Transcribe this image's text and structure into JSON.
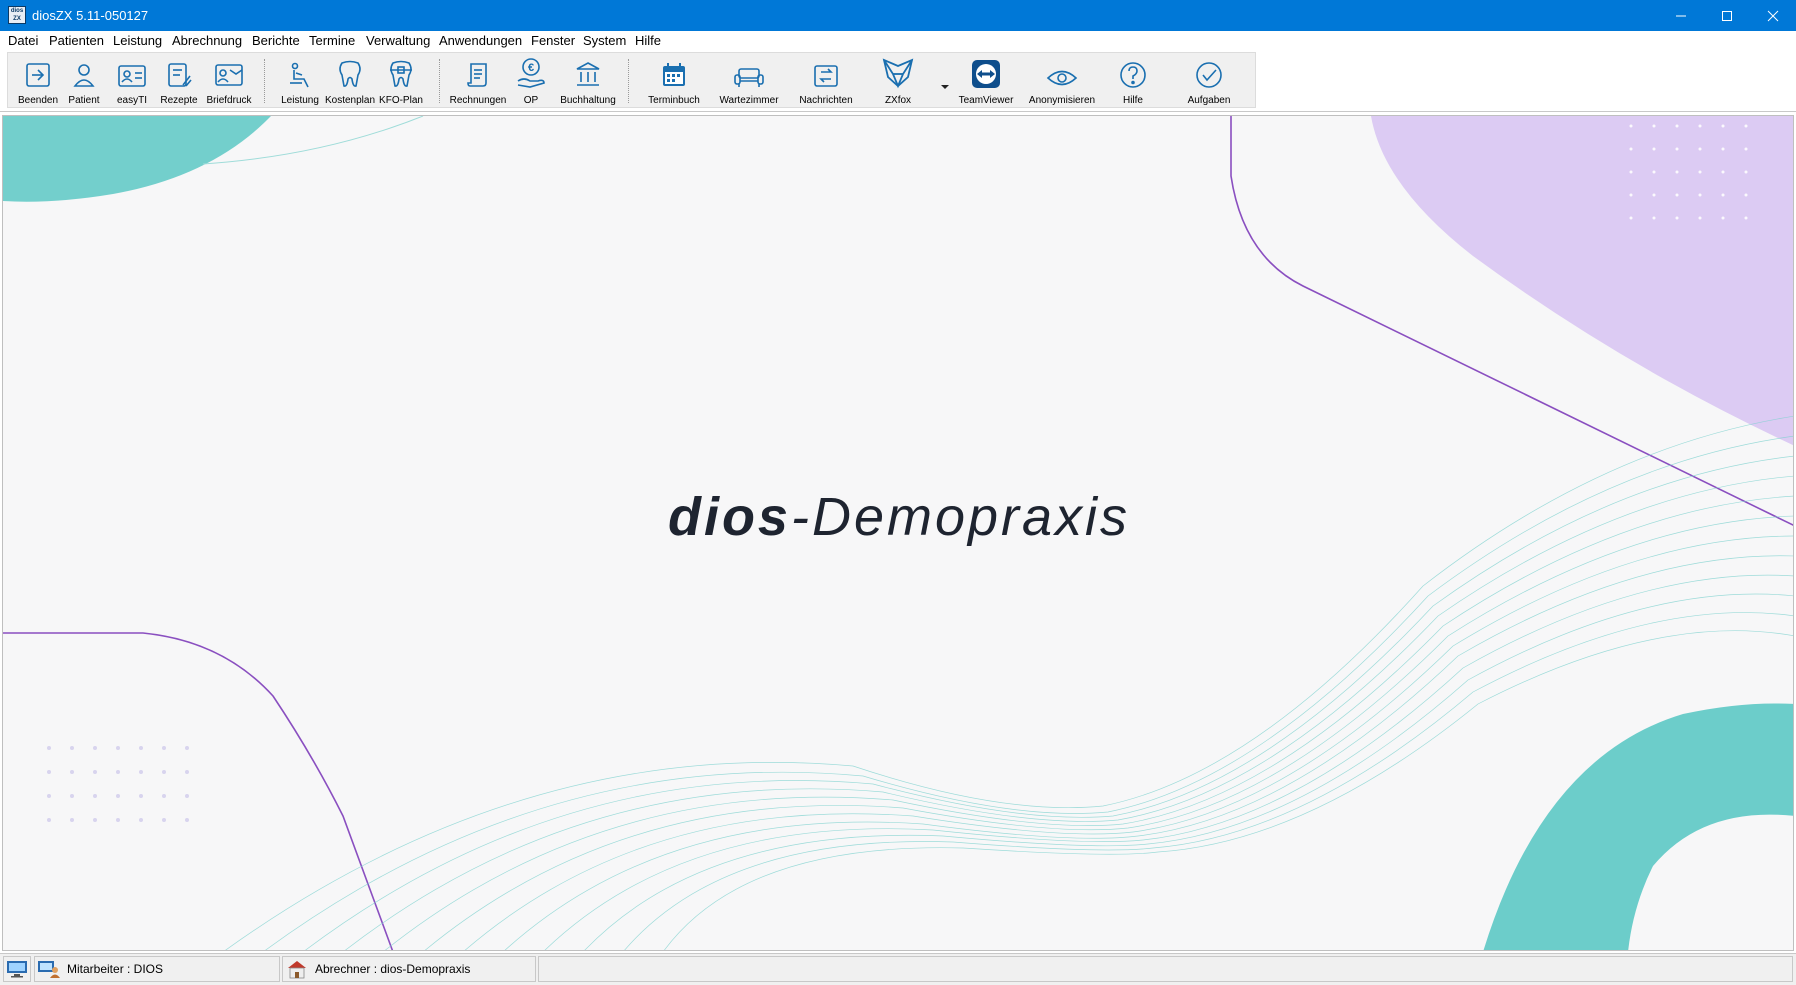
{
  "window": {
    "title": "diosZX 5.11-050127",
    "app_icon_text": "dios ZX"
  },
  "menu": [
    {
      "label": "Datei"
    },
    {
      "label": "Patienten"
    },
    {
      "label": "Leistung"
    },
    {
      "label": "Abrechnung"
    },
    {
      "label": "Berichte"
    },
    {
      "label": "Termine"
    },
    {
      "label": "Verwaltung"
    },
    {
      "label": "Anwendungen"
    },
    {
      "label": "Fenster"
    },
    {
      "label": "System"
    },
    {
      "label": "Hilfe"
    }
  ],
  "toolbar": [
    {
      "label": "Beenden",
      "icon": "exit-icon"
    },
    {
      "label": "Patient",
      "icon": "patient-icon"
    },
    {
      "label": "easyTI",
      "icon": "id-card-icon"
    },
    {
      "label": "Rezepte",
      "icon": "prescription-icon"
    },
    {
      "label": "Briefdruck",
      "icon": "letter-print-icon"
    },
    {
      "label": "Leistung",
      "icon": "dental-chair-icon"
    },
    {
      "label": "Kostenplan",
      "icon": "tooth-icon"
    },
    {
      "label": "KFO-Plan",
      "icon": "tooth-braces-icon"
    },
    {
      "label": "Rechnungen",
      "icon": "invoice-icon"
    },
    {
      "label": "OP",
      "icon": "euro-hand-icon"
    },
    {
      "label": "Buchhaltung",
      "icon": "bank-icon"
    },
    {
      "label": "Terminbuch",
      "icon": "calendar-icon"
    },
    {
      "label": "Wartezimmer",
      "icon": "sofa-icon"
    },
    {
      "label": "Nachrichten",
      "icon": "messages-icon"
    },
    {
      "label": "ZXfox",
      "icon": "fox-icon"
    },
    {
      "label": "TeamViewer",
      "icon": "teamviewer-icon"
    },
    {
      "label": "Anonymisieren",
      "icon": "eye-icon"
    },
    {
      "label": "Hilfe",
      "icon": "help-icon"
    },
    {
      "label": "Aufgaben",
      "icon": "check-icon"
    }
  ],
  "main": {
    "brand_bold": "dios",
    "brand_regular": "-Demopraxis"
  },
  "status": {
    "employee": "Mitarbeiter : DIOS",
    "biller": "Abrechner : dios-Demopraxis"
  },
  "colors": {
    "titlebar": "#0078d7",
    "icon_blue": "#1a6fb0",
    "teal": "#5cc8c4",
    "purple": "#8a4fc0",
    "lavender": "#dccbf3"
  }
}
